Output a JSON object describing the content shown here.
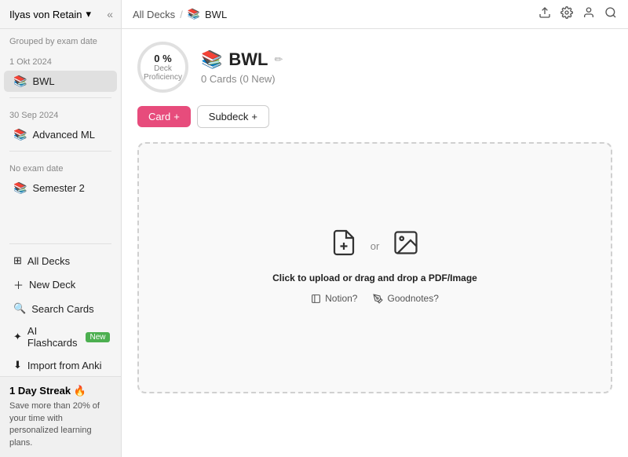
{
  "sidebar": {
    "user": "Ilyas von Retain",
    "chevron": "▾",
    "collapse_icon": "«",
    "grouped_label": "Grouped by exam date",
    "sections": [
      {
        "date": "1 Okt 2024",
        "items": [
          {
            "id": "bwl",
            "icon": "📚",
            "label": "BWL",
            "active": true
          }
        ]
      },
      {
        "date": "30 Sep 2024",
        "items": [
          {
            "id": "advanced-ml",
            "icon": "📚",
            "label": "Advanced ML",
            "active": false
          }
        ]
      },
      {
        "date": "No exam date",
        "items": [
          {
            "id": "semester-2",
            "icon": "📚",
            "label": "Semester 2",
            "active": false
          }
        ]
      }
    ],
    "bottom_nav": [
      {
        "id": "all-decks",
        "icon": "⊞",
        "label": "All Decks"
      },
      {
        "id": "new-deck",
        "icon": "+",
        "label": "New Deck"
      },
      {
        "id": "search-cards",
        "icon": "🔍",
        "label": "Search Cards"
      },
      {
        "id": "ai-flashcards",
        "icon": "✦",
        "label": "AI Flashcards",
        "badge": "New"
      },
      {
        "id": "import-from-anki",
        "icon": "⬇",
        "label": "Import from Anki"
      }
    ],
    "streak": {
      "title": "1 Day Streak 🔥",
      "description": "Save more than 20% of your time with personalized learning plans."
    }
  },
  "topbar": {
    "breadcrumb_all": "All Decks",
    "breadcrumb_sep": "/",
    "breadcrumb_deck_icon": "📚",
    "breadcrumb_deck": "BWL",
    "icons": [
      "upload-icon",
      "settings-icon",
      "profile-icon",
      "search-icon"
    ]
  },
  "deck": {
    "proficiency_percent": "0 %",
    "proficiency_label": "Deck",
    "proficiency_sublabel": "Proficiency",
    "icon": "📚",
    "title": "BWL",
    "edit_icon": "✏",
    "cards_count": "0 Cards (0 New)"
  },
  "actions": {
    "card_button": "Card",
    "card_plus": "+",
    "subdeck_button": "Subdeck",
    "subdeck_plus": "+"
  },
  "upload": {
    "or_text": "or",
    "upload_text_bold": "Click to upload",
    "upload_text_rest": " or drag and drop a PDF/Image",
    "notion_label": "Notion?",
    "goodnotes_label": "Goodnotes?"
  }
}
